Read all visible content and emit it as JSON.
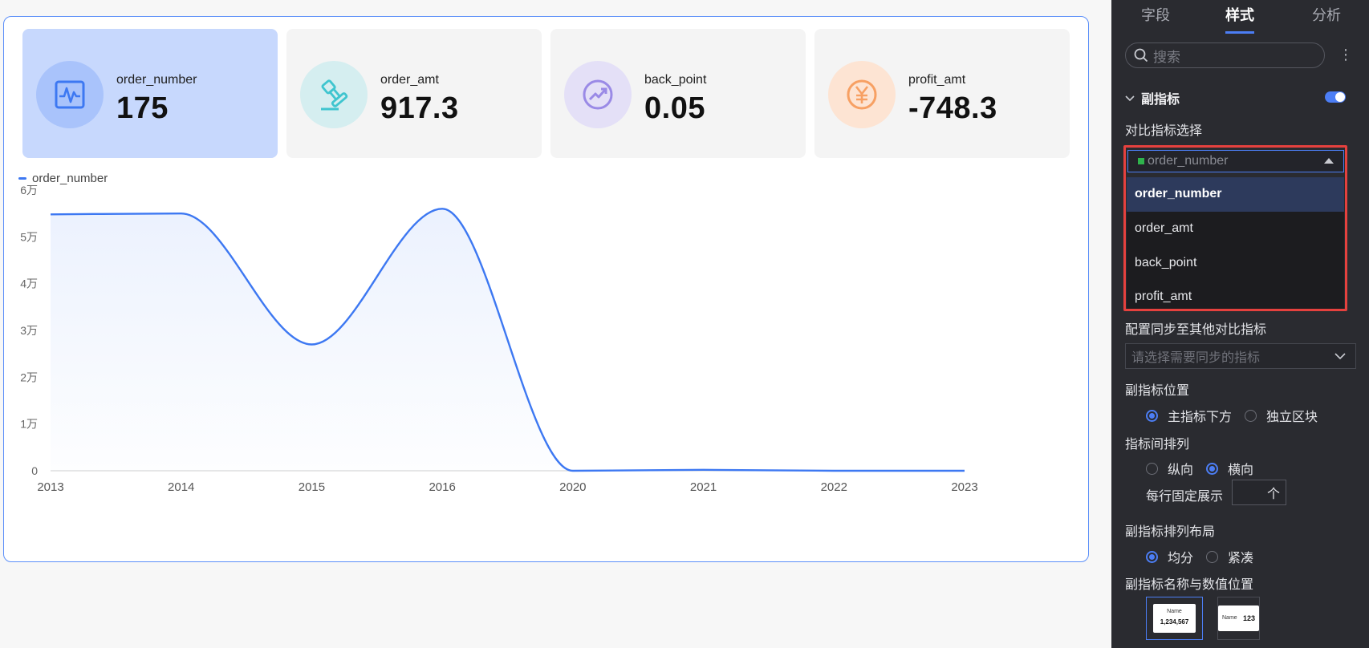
{
  "kpis": [
    {
      "name": "order_number",
      "value": "175",
      "icon": "pulse-icon",
      "bg": "#a9c3fb",
      "color": "#3d78f2"
    },
    {
      "name": "order_amt",
      "value": "917.3",
      "icon": "stamp-icon",
      "bg": "#d5eef0",
      "color": "#3fc5cf"
    },
    {
      "name": "back_point",
      "value": "0.05",
      "icon": "trend-up-icon",
      "bg": "#e4e0f7",
      "color": "#9a8ae6"
    },
    {
      "name": "profit_amt",
      "value": "-748.3",
      "icon": "yen-icon",
      "bg": "#fde4d3",
      "color": "#f7a063"
    }
  ],
  "chart_data": {
    "type": "area",
    "series": [
      {
        "name": "order_number",
        "values": [
          54800,
          55000,
          27000,
          56000,
          0,
          200,
          0,
          0
        ]
      }
    ],
    "categories": [
      "2013",
      "2014",
      "2015",
      "2016",
      "2020",
      "2021",
      "2022",
      "2023"
    ],
    "yticks": [
      "0",
      "1万",
      "2万",
      "3万",
      "4万",
      "5万",
      "6万"
    ],
    "ylim": [
      0,
      60000
    ],
    "color": "#3d78f2"
  },
  "panel": {
    "tabs": [
      "字段",
      "样式",
      "分析"
    ],
    "active_tab": "样式",
    "search_placeholder": "搜索",
    "section_title": "副指标",
    "compare_label": "对比指标选择",
    "selected_metric": "order_number",
    "options": [
      "order_number",
      "order_amt",
      "back_point",
      "profit_amt"
    ],
    "sync_label": "配置同步至其他对比指标",
    "sync_placeholder": "请选择需要同步的指标",
    "position_label": "副指标位置",
    "position_options": [
      "主指标下方",
      "独立区块"
    ],
    "arrange_label": "指标间排列",
    "arrange_options": [
      "纵向",
      "横向"
    ],
    "per_row_label": "每行固定展示",
    "per_row_unit": "个",
    "layout_label": "副指标排列布局",
    "layout_options": [
      "均分",
      "紧凑"
    ],
    "name_value_label": "副指标名称与数值位置",
    "preview1": {
      "name": "Name",
      "value": "1,234,567"
    },
    "preview2": {
      "name": "Name",
      "value": "123"
    },
    "accent": "#4c7ef5",
    "highlight_border": "#e5413e"
  }
}
